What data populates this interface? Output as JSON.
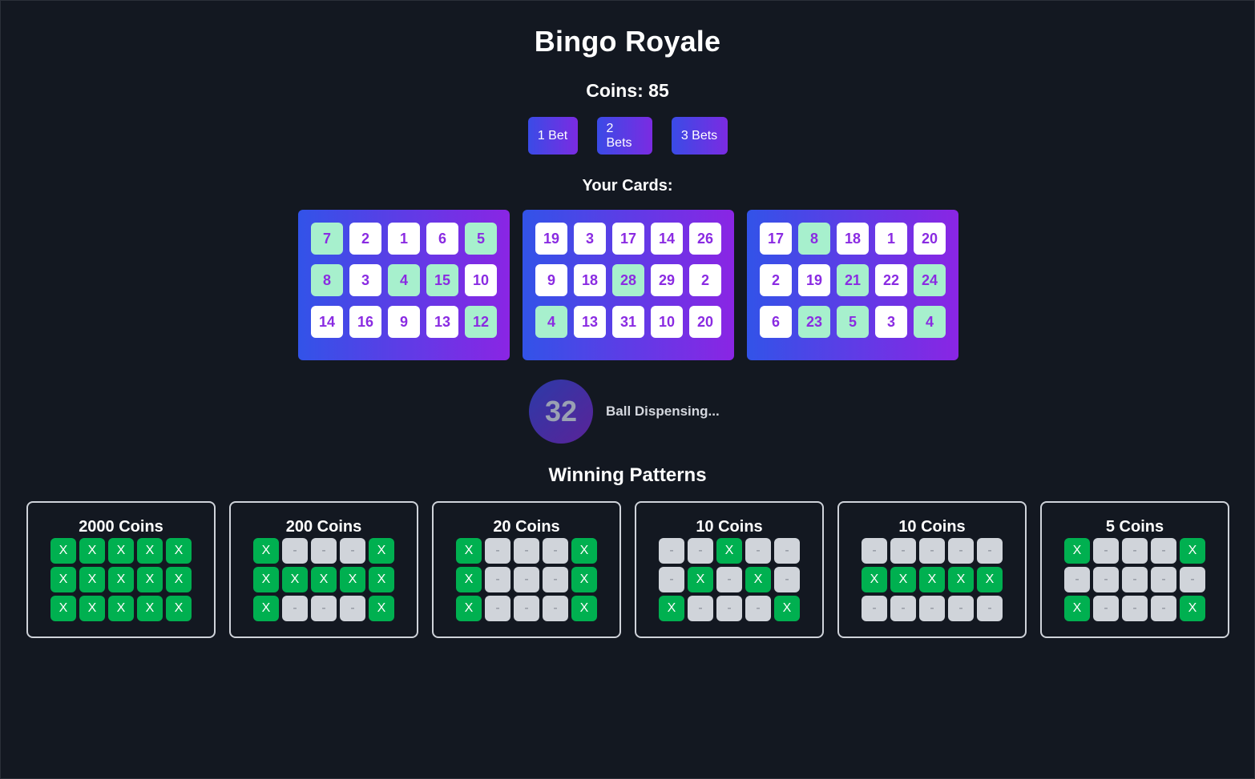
{
  "app": {
    "title": "Bingo Royale"
  },
  "coins": {
    "label": "Coins: 85",
    "value": 85
  },
  "bets": [
    {
      "label": "1 Bet"
    },
    {
      "label": "2 Bets"
    },
    {
      "label": "3 Bets"
    }
  ],
  "cards_heading": "Your Cards:",
  "cards": [
    {
      "rows": [
        [
          {
            "n": "7",
            "m": true
          },
          {
            "n": "2",
            "m": false
          },
          {
            "n": "1",
            "m": false
          },
          {
            "n": "6",
            "m": false
          },
          {
            "n": "5",
            "m": true
          }
        ],
        [
          {
            "n": "8",
            "m": true
          },
          {
            "n": "3",
            "m": false
          },
          {
            "n": "4",
            "m": true
          },
          {
            "n": "15",
            "m": true
          },
          {
            "n": "10",
            "m": false
          }
        ],
        [
          {
            "n": "14",
            "m": false
          },
          {
            "n": "16",
            "m": false
          },
          {
            "n": "9",
            "m": false
          },
          {
            "n": "13",
            "m": false
          },
          {
            "n": "12",
            "m": true
          }
        ]
      ]
    },
    {
      "rows": [
        [
          {
            "n": "19",
            "m": false
          },
          {
            "n": "3",
            "m": false
          },
          {
            "n": "17",
            "m": false
          },
          {
            "n": "14",
            "m": false
          },
          {
            "n": "26",
            "m": false
          }
        ],
        [
          {
            "n": "9",
            "m": false
          },
          {
            "n": "18",
            "m": false
          },
          {
            "n": "28",
            "m": true
          },
          {
            "n": "29",
            "m": false
          },
          {
            "n": "2",
            "m": false
          }
        ],
        [
          {
            "n": "4",
            "m": true
          },
          {
            "n": "13",
            "m": false
          },
          {
            "n": "31",
            "m": false
          },
          {
            "n": "10",
            "m": false
          },
          {
            "n": "20",
            "m": false
          }
        ]
      ]
    },
    {
      "rows": [
        [
          {
            "n": "17",
            "m": false
          },
          {
            "n": "8",
            "m": true
          },
          {
            "n": "18",
            "m": false
          },
          {
            "n": "1",
            "m": false
          },
          {
            "n": "20",
            "m": false
          }
        ],
        [
          {
            "n": "2",
            "m": false
          },
          {
            "n": "19",
            "m": false
          },
          {
            "n": "21",
            "m": true
          },
          {
            "n": "22",
            "m": false
          },
          {
            "n": "24",
            "m": true
          }
        ],
        [
          {
            "n": "6",
            "m": false
          },
          {
            "n": "23",
            "m": true
          },
          {
            "n": "5",
            "m": true
          },
          {
            "n": "3",
            "m": false
          },
          {
            "n": "4",
            "m": true
          }
        ]
      ]
    }
  ],
  "ball": {
    "number": "32",
    "status": "Ball Dispensing..."
  },
  "patterns_heading": "Winning Patterns",
  "patterns": [
    {
      "label": "2000 Coins",
      "grid": [
        "XXXXX",
        "XXXXX",
        "XXXXX"
      ]
    },
    {
      "label": "200 Coins",
      "grid": [
        "X---X",
        "XXXXX",
        "X---X"
      ]
    },
    {
      "label": "20 Coins",
      "grid": [
        "X---X",
        "X---X",
        "X---X"
      ]
    },
    {
      "label": "10 Coins",
      "grid": [
        "--X--",
        "-X-X-",
        "X---X"
      ]
    },
    {
      "label": "10 Coins",
      "grid": [
        "-----",
        "XXXXX",
        "-----"
      ]
    },
    {
      "label": "5 Coins",
      "grid": [
        "X---X",
        "-----",
        "X---X"
      ]
    }
  ],
  "pattern_glyphs": {
    "hit": "X",
    "miss": "-"
  },
  "colors": {
    "background": "#131821",
    "accent_start": "#3a4be6",
    "accent_end": "#8a25e4",
    "marked_cell": "#a7f0cd",
    "pattern_hit": "#00b050",
    "pattern_miss": "#d0d4da"
  }
}
